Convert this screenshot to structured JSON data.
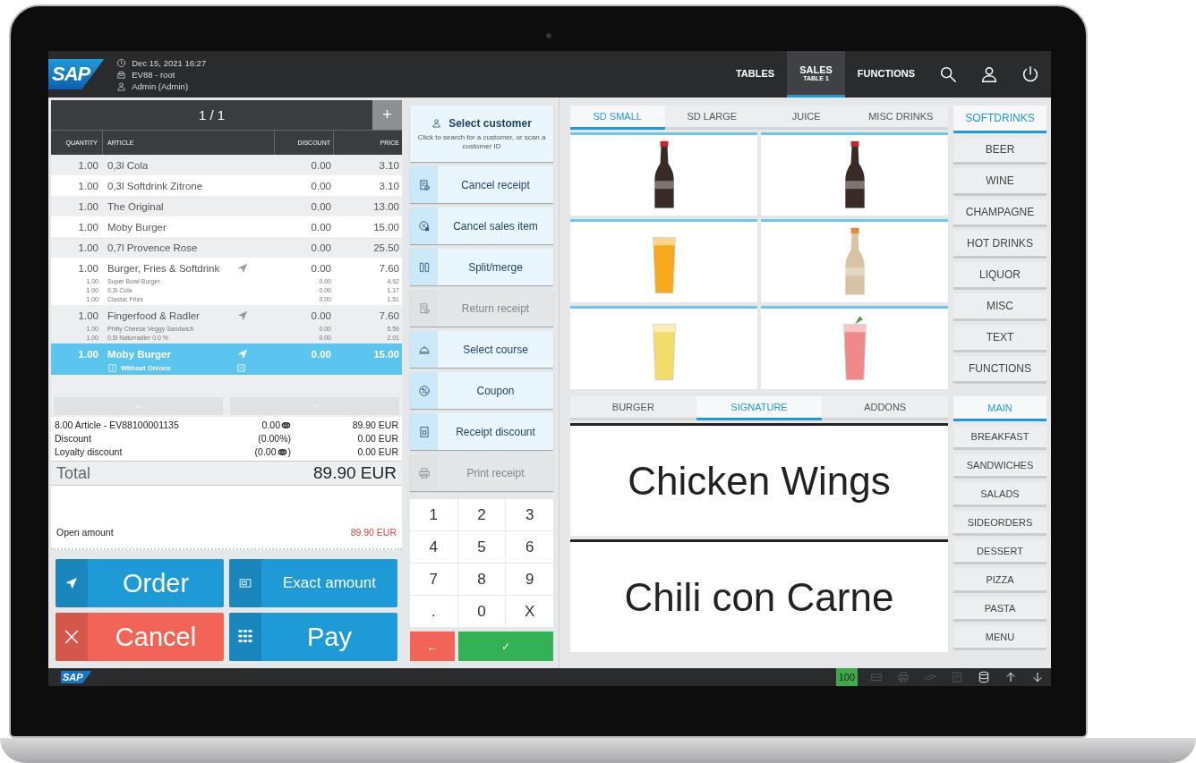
{
  "header": {
    "logo": "SAP",
    "info": [
      {
        "kind": "clock",
        "text": "Dec 15, 2021 16:27"
      },
      {
        "kind": "register",
        "text": "EV88 - root"
      },
      {
        "kind": "user",
        "text": "Admin (Admin)"
      }
    ],
    "nav": [
      {
        "label": "TABLES",
        "selected": false
      },
      {
        "label": "SALES",
        "sublabel": "TABLE 1",
        "selected": true
      },
      {
        "label": "FUNCTIONS",
        "selected": false
      }
    ],
    "tools": [
      {
        "kind": "search"
      },
      {
        "kind": "user"
      },
      {
        "kind": "power"
      }
    ]
  },
  "receipt": {
    "pager": "1 / 1",
    "add": "+",
    "columns": [
      "QUANTITY",
      "ARTICLE",
      "DISCOUNT",
      "PRICE"
    ],
    "rows": [
      {
        "quantity": "1.00",
        "article": "0,3l Cola",
        "discount": "0.00",
        "price": "3.10",
        "sent": false,
        "selected": false
      },
      {
        "quantity": "1.00",
        "article": "0,3l Softdrink Zitrone",
        "discount": "0.00",
        "price": "3.10",
        "sent": false,
        "selected": false
      },
      {
        "quantity": "1.00",
        "article": "The Original",
        "discount": "0.00",
        "price": "13.00",
        "sent": false,
        "selected": false
      },
      {
        "quantity": "1.00",
        "article": "Moby Burger",
        "discount": "0.00",
        "price": "15.00",
        "sent": false,
        "selected": false
      },
      {
        "quantity": "1.00",
        "article": "0,7l Provence Rose",
        "discount": "0.00",
        "price": "25.50",
        "sent": false,
        "selected": false
      },
      {
        "quantity": "1.00",
        "article": "Burger, Fries & Softdrink",
        "discount": "0.00",
        "price": "7.60",
        "sent": true,
        "selected": false,
        "components": [
          {
            "quantity": "1.00",
            "article": "Super Bowl Burger",
            "discount": "0.00",
            "price": "4.92"
          },
          {
            "quantity": "1.00",
            "article": "0,3l Cola",
            "discount": "0.00",
            "price": "1.17"
          },
          {
            "quantity": "1.00",
            "article": "Classic Fries",
            "discount": "0.00",
            "price": "1.51"
          }
        ]
      },
      {
        "quantity": "1.00",
        "article": "Fingerfood & Radler",
        "discount": "0.00",
        "price": "7.60",
        "sent": true,
        "selected": false,
        "components": [
          {
            "quantity": "1.00",
            "article": "Philly Cheese Veggy Sandwich",
            "discount": "0.00",
            "price": "5.59"
          },
          {
            "quantity": "1.00",
            "article": "0,5l Naturradler 0.0 %",
            "discount": "0.00",
            "price": "2.01"
          }
        ]
      },
      {
        "quantity": "1.00",
        "article": "Moby Burger",
        "discount": "0.00",
        "price": "15.00",
        "sent": true,
        "selected": true,
        "note": "Without Onions"
      }
    ],
    "summary": [
      {
        "label": "8.00 Article - EV88100001135",
        "value": "0.00",
        "coin": true,
        "amount": "89.90 EUR"
      },
      {
        "label": "Discount",
        "value": "(0.00%)",
        "coin": false,
        "amount": "0.00 EUR"
      },
      {
        "label": "Loyalty discount",
        "value": "(0.00",
        "coin": true,
        "suffix": ")",
        "amount": "0.00 EUR"
      }
    ],
    "total": {
      "label": "Total",
      "amount": "89.90 EUR"
    },
    "open_amount": {
      "label": "Open amount",
      "amount": "89.90 EUR"
    }
  },
  "actions": [
    {
      "label": "Order",
      "kind": "order"
    },
    {
      "label": "Exact amount",
      "kind": "exact"
    },
    {
      "label": "Cancel",
      "kind": "cancel"
    },
    {
      "label": "Pay",
      "kind": "pay"
    }
  ],
  "customer": {
    "title": "Select customer",
    "hint": "Click to search for a customer, or scan a customer ID"
  },
  "functions": [
    {
      "label": "Cancel receipt",
      "kind": "cancel_receipt",
      "disabled": false
    },
    {
      "label": "Cancel sales item",
      "kind": "cancel_item",
      "disabled": false
    },
    {
      "label": "Split/merge",
      "kind": "split",
      "disabled": false
    },
    {
      "label": "Return receipt",
      "kind": "return_receipt",
      "disabled": true
    },
    {
      "label": "Select course",
      "kind": "course",
      "disabled": false
    },
    {
      "label": "Coupon",
      "kind": "coupon",
      "disabled": false
    },
    {
      "label": "Receipt discount",
      "kind": "receipt_discount",
      "disabled": false
    },
    {
      "label": "Print receipt",
      "kind": "print",
      "disabled": true
    }
  ],
  "keypad": {
    "keys": [
      "1",
      "2",
      "3",
      "4",
      "5",
      "6",
      "7",
      "8",
      "9",
      ".",
      "0",
      "X"
    ],
    "back": "←",
    "confirm": "✓"
  },
  "product_tabs": [
    {
      "label": "SD SMALL",
      "selected": true
    },
    {
      "label": "SD LARGE",
      "selected": false
    },
    {
      "label": "JUICE",
      "selected": false
    },
    {
      "label": "MISC DRINKS",
      "selected": false
    }
  ],
  "products": [
    {
      "kind": "cola"
    },
    {
      "kind": "cola"
    },
    {
      "kind": "orange_juice"
    },
    {
      "kind": "plastic_bottle"
    },
    {
      "kind": "lemonade"
    },
    {
      "kind": "red_drink"
    }
  ],
  "categories": [
    {
      "label": "SOFTDRINKS",
      "selected": true
    },
    {
      "label": "BEER",
      "selected": false
    },
    {
      "label": "WINE",
      "selected": false
    },
    {
      "label": "CHAMPAGNE",
      "selected": false
    },
    {
      "label": "HOT DRINKS",
      "selected": false
    },
    {
      "label": "LIQUOR",
      "selected": false
    },
    {
      "label": "MISC",
      "selected": false
    },
    {
      "label": "TEXT",
      "selected": false
    },
    {
      "label": "FUNCTIONS",
      "selected": false
    }
  ],
  "menu_tabs": [
    {
      "label": "BURGER",
      "selected": false
    },
    {
      "label": "SIGNATURE",
      "selected": true
    },
    {
      "label": "ADDONS",
      "selected": false
    }
  ],
  "menu_items": [
    "Chicken Wings",
    "Chili con Carne"
  ],
  "menu_categories": [
    {
      "label": "MAIN",
      "selected": true
    },
    {
      "label": "BREAKFAST",
      "selected": false
    },
    {
      "label": "SANDWICHES",
      "selected": false
    },
    {
      "label": "SALADS",
      "selected": false
    },
    {
      "label": "SIDEORDERS",
      "selected": false
    },
    {
      "label": "DESSERT",
      "selected": false
    },
    {
      "label": "PIZZA",
      "selected": false
    },
    {
      "label": "PASTA",
      "selected": false
    },
    {
      "label": "MENU",
      "selected": false
    }
  ],
  "status_bar": {
    "logo": "SAP",
    "counter": "100",
    "icons": [
      {
        "kind": "drawer",
        "disabled": true
      },
      {
        "kind": "printer",
        "disabled": true
      },
      {
        "kind": "scanner",
        "disabled": true
      },
      {
        "kind": "display",
        "disabled": true
      },
      {
        "kind": "database",
        "disabled": false
      },
      {
        "kind": "arrow_up",
        "disabled": false
      },
      {
        "kind": "arrow_down",
        "disabled": false
      }
    ]
  }
}
